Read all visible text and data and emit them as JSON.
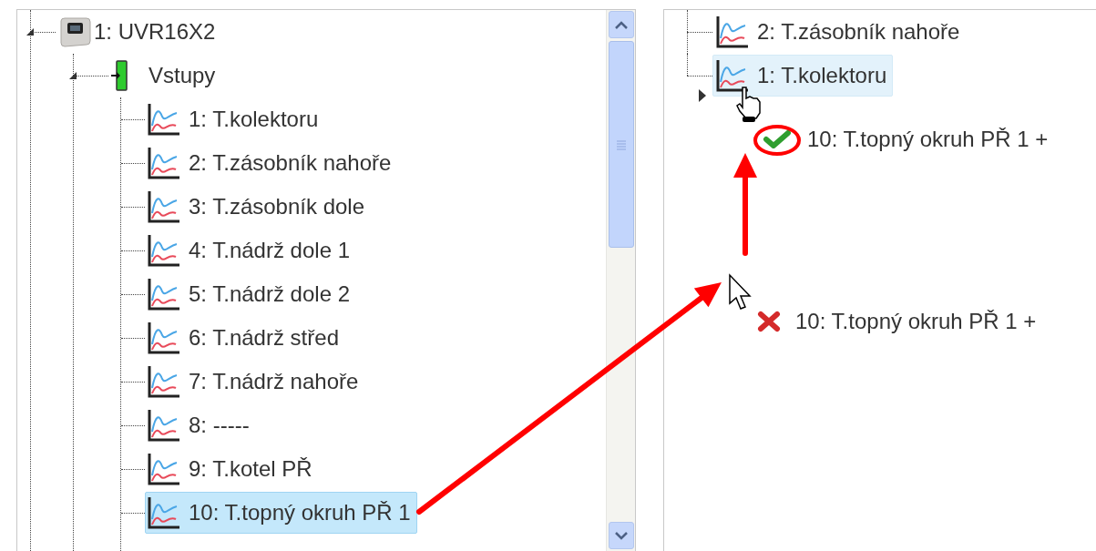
{
  "left_tree": {
    "items": [
      {
        "label": "1: UVR16X2",
        "kind": "device",
        "expanded": true,
        "selected": false,
        "children": [
          {
            "label": "Vstupy",
            "kind": "inputs",
            "expanded": true,
            "selected": false,
            "children": [
              {
                "label": "1: T.kolektoru",
                "kind": "chart",
                "selected": false
              },
              {
                "label": "2: T.zásobník nahoře",
                "kind": "chart",
                "selected": false
              },
              {
                "label": "3: T.zásobník dole",
                "kind": "chart",
                "selected": false
              },
              {
                "label": "4: T.nádrž dole 1",
                "kind": "chart",
                "selected": false
              },
              {
                "label": "5: T.nádrž dole 2",
                "kind": "chart",
                "selected": false
              },
              {
                "label": "6: T.nádrž střed",
                "kind": "chart",
                "selected": false
              },
              {
                "label": "7: T.nádrž nahoře",
                "kind": "chart",
                "selected": false
              },
              {
                "label": "8: -----",
                "kind": "chart",
                "selected": false
              },
              {
                "label": "9: T.kotel PŘ",
                "kind": "chart",
                "selected": false
              },
              {
                "label": "10: T.topný okruh PŘ 1",
                "kind": "chart",
                "selected": true
              }
            ]
          }
        ]
      }
    ]
  },
  "right_tree": {
    "items": [
      {
        "label": "2: T.zásobník nahoře",
        "kind": "chart",
        "hovered": false
      },
      {
        "label": "1: T.kolektoru",
        "kind": "chart",
        "hovered": true
      }
    ]
  },
  "drag_feedback": [
    {
      "label": "10: T.topný okruh PŘ 1 +",
      "kind": "allowed"
    },
    {
      "label": "10: T.topný okruh PŘ 1 +",
      "kind": "denied"
    }
  ]
}
